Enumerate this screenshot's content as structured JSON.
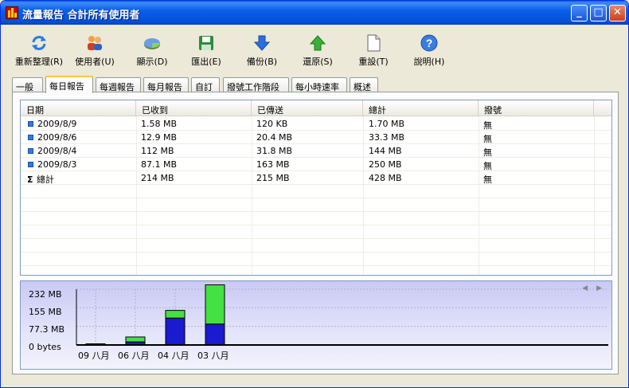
{
  "window": {
    "title": "流量報告 合計所有使用者",
    "minimize_glyph": "_",
    "maximize_glyph": "□",
    "close_glyph": "✕"
  },
  "toolbar": [
    {
      "label": "重新整理(R)",
      "icon": "refresh-icon"
    },
    {
      "label": "使用者(U)",
      "icon": "users-icon"
    },
    {
      "label": "顯示(D)",
      "icon": "pie-chart-icon"
    },
    {
      "label": "匯出(E)",
      "icon": "save-icon"
    },
    {
      "label": "備份(B)",
      "icon": "down-arrow-icon"
    },
    {
      "label": "還原(S)",
      "icon": "up-arrow-icon"
    },
    {
      "label": "重設(T)",
      "icon": "document-icon"
    },
    {
      "label": "說明(H)",
      "icon": "help-icon"
    }
  ],
  "tabs": [
    "一般",
    "每日報告",
    "每週報告",
    "每月報告",
    "自訂",
    "撥號工作階段",
    "每小時速率",
    "概述"
  ],
  "active_tab": "每日報告",
  "table": {
    "columns": [
      "日期",
      "已收到",
      "已傳送",
      "總計",
      "撥號"
    ],
    "rows": [
      {
        "date": "2009/8/9",
        "received": "1.58 MB",
        "sent": "120 KB",
        "total": "1.70 MB",
        "dialup": "無"
      },
      {
        "date": "2009/8/6",
        "received": "12.9 MB",
        "sent": "20.4 MB",
        "total": "33.3 MB",
        "dialup": "無"
      },
      {
        "date": "2009/8/4",
        "received": "112 MB",
        "sent": "31.8 MB",
        "total": "144 MB",
        "dialup": "無"
      },
      {
        "date": "2009/8/3",
        "received": "87.1 MB",
        "sent": "163 MB",
        "total": "250 MB",
        "dialup": "無"
      }
    ],
    "total_row": {
      "symbol": "Σ",
      "label": "總計",
      "received": "214 MB",
      "sent": "215 MB",
      "total": "428 MB",
      "dialup": "無"
    }
  },
  "chart_data": {
    "type": "bar",
    "stacked": true,
    "categories": [
      "09 八月",
      "06 八月",
      "04 八月",
      "03 八月"
    ],
    "series": [
      {
        "color": "#1a1ad0",
        "values": [
          1.58,
          12.9,
          112,
          87.1
        ]
      },
      {
        "color": "#44e044",
        "values": [
          0.12,
          20.4,
          31.8,
          163
        ]
      }
    ],
    "y_ticks": [
      "0 bytes",
      "77.3 MB",
      "155 MB",
      "232 MB"
    ],
    "y_tick_values": [
      0,
      77.3,
      155,
      232
    ],
    "ylim": [
      0,
      232
    ],
    "grid": true,
    "nav_arrows": "◀ ▶"
  },
  "colors": {
    "titlebar": "#0a5fe8",
    "received_bar": "#1a1ad0",
    "sent_bar": "#44e044",
    "active_tab_accent": "#ffc83c"
  }
}
